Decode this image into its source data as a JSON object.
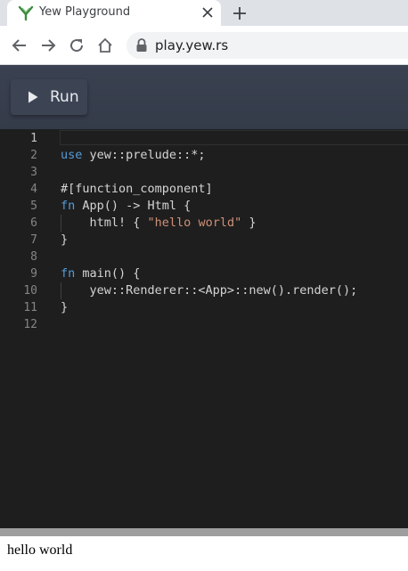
{
  "browser": {
    "tab_title": "Yew Playground",
    "url": "play.yew.rs",
    "favicon_icon": "yew-logo-icon",
    "accent": "#3c8a3c"
  },
  "app": {
    "run_label": "Run"
  },
  "editor": {
    "line_numbers": [
      "1",
      "2",
      "3",
      "4",
      "5",
      "6",
      "7",
      "8",
      "9",
      "10",
      "11",
      "12"
    ],
    "lines": [
      [],
      [
        {
          "t": "kw",
          "s": "use"
        },
        {
          "t": "plain",
          "s": " yew::prelude::*;"
        }
      ],
      [],
      [
        {
          "t": "plain",
          "s": "#[function_component]"
        }
      ],
      [
        {
          "t": "kw",
          "s": "fn"
        },
        {
          "t": "plain",
          "s": " App() -> Html {"
        }
      ],
      [
        {
          "t": "plain",
          "s": "    html! { "
        },
        {
          "t": "str",
          "s": "\"hello world\""
        },
        {
          "t": "plain",
          "s": " }"
        }
      ],
      [
        {
          "t": "plain",
          "s": "}"
        }
      ],
      [],
      [
        {
          "t": "kw",
          "s": "fn"
        },
        {
          "t": "plain",
          "s": " main() {"
        }
      ],
      [
        {
          "t": "plain",
          "s": "    yew::Renderer::<App>::new().render();"
        }
      ],
      [
        {
          "t": "plain",
          "s": "}"
        }
      ],
      []
    ]
  },
  "output": {
    "text": "hello world"
  }
}
